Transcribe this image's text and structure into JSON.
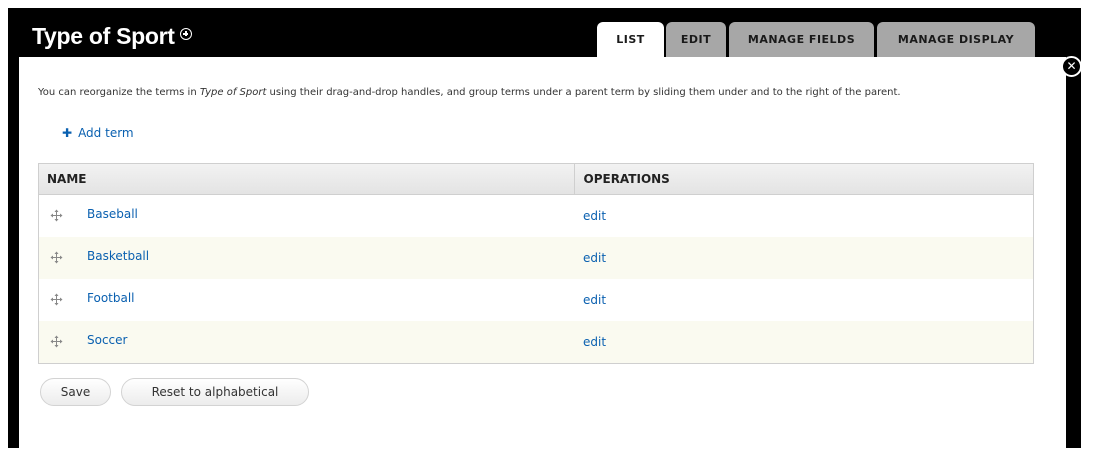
{
  "header": {
    "title": "Type of Sport",
    "title_icon": "add-circle-icon"
  },
  "tabs": [
    {
      "label": "LIST",
      "active": true
    },
    {
      "label": "EDIT",
      "active": false
    },
    {
      "label": "MANAGE FIELDS",
      "active": false
    },
    {
      "label": "MANAGE DISPLAY",
      "active": false
    }
  ],
  "close_icon": "close-icon",
  "description": {
    "before": "You can reorganize the terms in ",
    "vocab": "Type of Sport",
    "after": " using their drag-and-drop handles, and group terms under a parent term by sliding them under and to the right of the parent."
  },
  "add_term": {
    "label": "Add term",
    "icon": "plus-icon"
  },
  "table": {
    "headers": {
      "name": "NAME",
      "operations": "OPERATIONS"
    },
    "rows": [
      {
        "name": "Baseball",
        "operation": "edit"
      },
      {
        "name": "Basketball",
        "operation": "edit"
      },
      {
        "name": "Football",
        "operation": "edit"
      },
      {
        "name": "Soccer",
        "operation": "edit"
      }
    ]
  },
  "buttons": {
    "save": "Save",
    "reset": "Reset to alphabetical"
  },
  "colors": {
    "link": "#0a60b0",
    "overlay": "#000000",
    "tab_inactive": "#a7a7a7",
    "row_even": "#fafaf0"
  }
}
